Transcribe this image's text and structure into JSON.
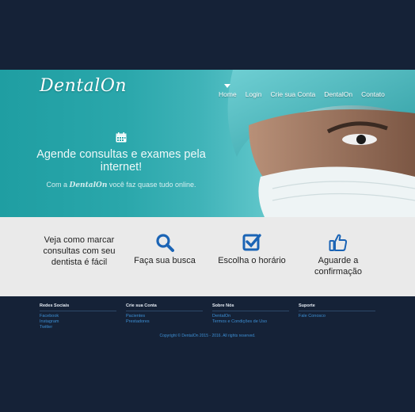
{
  "brand": {
    "logo_text": "DentalOn"
  },
  "nav": {
    "items": [
      "Home",
      "Login",
      "Crie sua Conta",
      "DentalOn",
      "Contato"
    ],
    "active": "Home"
  },
  "hero": {
    "icon": "calendar-icon",
    "title": "Agende consultas e exames pela internet!",
    "subtitle_prefix": "Com a",
    "subtitle_brand": "DentalOn",
    "subtitle_suffix": "você faz quase tudo online."
  },
  "steps": {
    "intro": "Veja como marcar consultas com seu dentista é fácil",
    "items": [
      {
        "icon": "search-icon",
        "label": "Faça sua busca"
      },
      {
        "icon": "checkbox-icon",
        "label": "Escolha o horário"
      },
      {
        "icon": "thumbs-up-icon",
        "label": "Aguarde a confirmação"
      }
    ]
  },
  "footer": {
    "columns": [
      {
        "title": "Redes Sociais",
        "links": [
          "Facebook",
          "Instagram",
          "Twitter"
        ]
      },
      {
        "title": "Crie sua Conta",
        "links": [
          "Pacientes",
          "Prestadores"
        ]
      },
      {
        "title": "Sobre Nós",
        "links": [
          "DentalOn",
          "Termos e Condições de Uso"
        ]
      },
      {
        "title": "Suporte",
        "links": [
          "Fale Conosco"
        ]
      }
    ],
    "copyright": "Copyright © DentalOn 2015 - 2016. All rights reserved."
  },
  "colors": {
    "background": "#152237",
    "hero_teal": "#2aa7ab",
    "accent_blue": "#1b64b5",
    "steps_bg": "#eaeaea",
    "footer_link": "#3d8fd4"
  }
}
